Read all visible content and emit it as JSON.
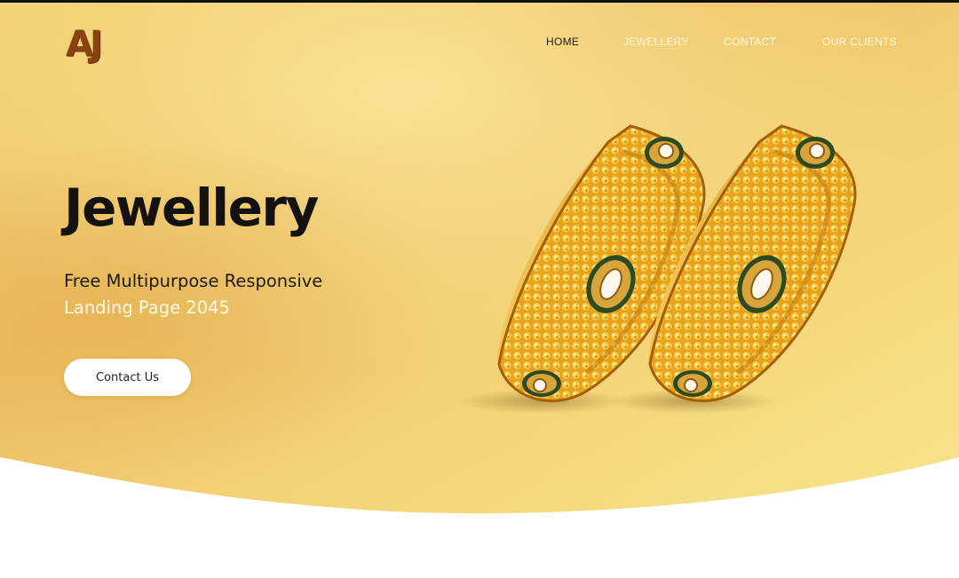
{
  "brand": {
    "logo_text": "AJ"
  },
  "nav": {
    "items": [
      {
        "label": "HOME",
        "active": true
      },
      {
        "label": "JEWELLERY",
        "active": false
      },
      {
        "label": "CONTACT",
        "active": false
      },
      {
        "label": "OUR CLIENTS",
        "active": false
      }
    ]
  },
  "hero": {
    "title": "Jewellery",
    "subtitle_line1": "Free Multipurpose Responsive",
    "subtitle_line2": "Landing Page 2045",
    "cta_label": "Contact Us",
    "image": "gold-bangles-pair"
  },
  "colors": {
    "hero_gold_light": "#f7dd7c",
    "hero_gold_dark": "#e9b957",
    "logo_brown": "#8a4210",
    "nav_active": "#1d1a12",
    "nav_inactive": "#fff6dc",
    "title": "#141210",
    "cta_bg": "#ffffff"
  }
}
